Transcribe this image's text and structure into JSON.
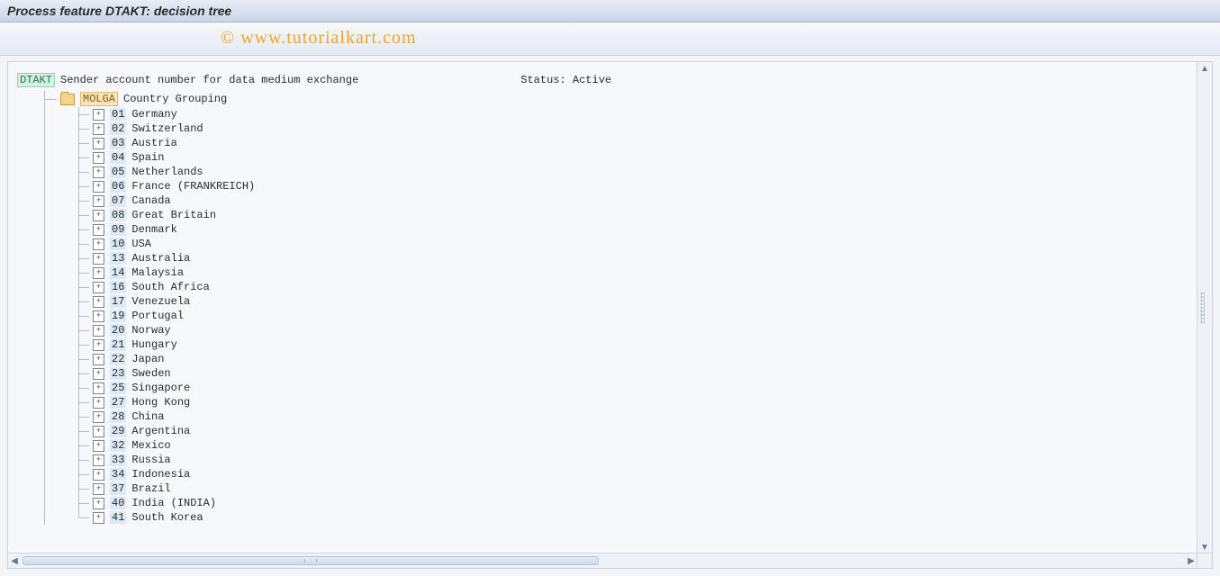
{
  "window": {
    "title": "Process feature DTAKT: decision tree"
  },
  "watermark": "© www.tutorialkart.com",
  "header": {
    "feature_code": "DTAKT",
    "feature_desc": "Sender account number for data medium exchange",
    "status_label": "Status:",
    "status_value": "Active"
  },
  "root_node": {
    "code": "MOLGA",
    "label": "Country Grouping"
  },
  "children": [
    {
      "code": "01",
      "name": "Germany"
    },
    {
      "code": "02",
      "name": "Switzerland"
    },
    {
      "code": "03",
      "name": "Austria"
    },
    {
      "code": "04",
      "name": "Spain"
    },
    {
      "code": "05",
      "name": "Netherlands"
    },
    {
      "code": "06",
      "name": "France (FRANKREICH)"
    },
    {
      "code": "07",
      "name": "Canada"
    },
    {
      "code": "08",
      "name": "Great Britain"
    },
    {
      "code": "09",
      "name": "Denmark"
    },
    {
      "code": "10",
      "name": "USA"
    },
    {
      "code": "13",
      "name": "Australia"
    },
    {
      "code": "14",
      "name": "Malaysia"
    },
    {
      "code": "16",
      "name": "South Africa"
    },
    {
      "code": "17",
      "name": "Venezuela"
    },
    {
      "code": "19",
      "name": "Portugal"
    },
    {
      "code": "20",
      "name": "Norway"
    },
    {
      "code": "21",
      "name": "Hungary"
    },
    {
      "code": "22",
      "name": "Japan"
    },
    {
      "code": "23",
      "name": "Sweden"
    },
    {
      "code": "25",
      "name": "Singapore"
    },
    {
      "code": "27",
      "name": "Hong Kong"
    },
    {
      "code": "28",
      "name": "China"
    },
    {
      "code": "29",
      "name": "Argentina"
    },
    {
      "code": "32",
      "name": "Mexico"
    },
    {
      "code": "33",
      "name": "Russia"
    },
    {
      "code": "34",
      "name": "Indonesia"
    },
    {
      "code": "37",
      "name": "Brazil"
    },
    {
      "code": "40",
      "name": "India (INDIA)"
    },
    {
      "code": "41",
      "name": "South Korea"
    }
  ],
  "glyphs": {
    "up": "▲",
    "down": "▼",
    "left": "◀",
    "right": "▶",
    "plus": "+"
  }
}
